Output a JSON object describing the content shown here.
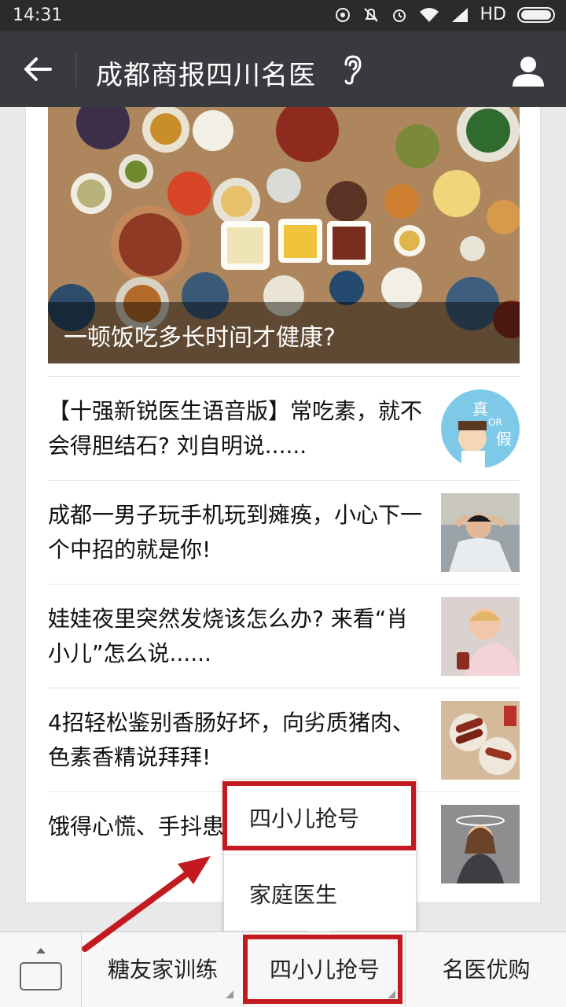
{
  "status_bar": {
    "time": "14:31",
    "network": "HD"
  },
  "header": {
    "title": "成都商报四川名医"
  },
  "hero": {
    "caption": "一顿饭吃多长时间才健康?"
  },
  "articles": [
    {
      "text": "【十强新锐医生语音版】常吃素，就不会得胆结石? 刘自明说......",
      "thumb_text_top": "真",
      "thumb_text_mid": "OR",
      "thumb_text_bottom": "假"
    },
    {
      "text": "成都一男子玩手机玩到瘫痪，小心下一个中招的就是你!"
    },
    {
      "text": "娃娃夜里突然发烧该怎么办? 来看“肖小儿”怎么说......"
    },
    {
      "text": "4招轻松鉴别香肠好坏，向劣质猪肉、色素香精说拜拜!"
    },
    {
      "text": "饿得心慌、手抖患病的征兆啊!"
    }
  ],
  "popup_menu": {
    "items": [
      "四小儿抢号",
      "家庭医生"
    ]
  },
  "bottom_menu": {
    "items": [
      "糖友家训练",
      "四小儿抢号",
      "名医优购"
    ]
  },
  "colors": {
    "highlight": "#c21a1f",
    "titlebar": "#393a3f",
    "statusbar": "#2b2b2b"
  }
}
